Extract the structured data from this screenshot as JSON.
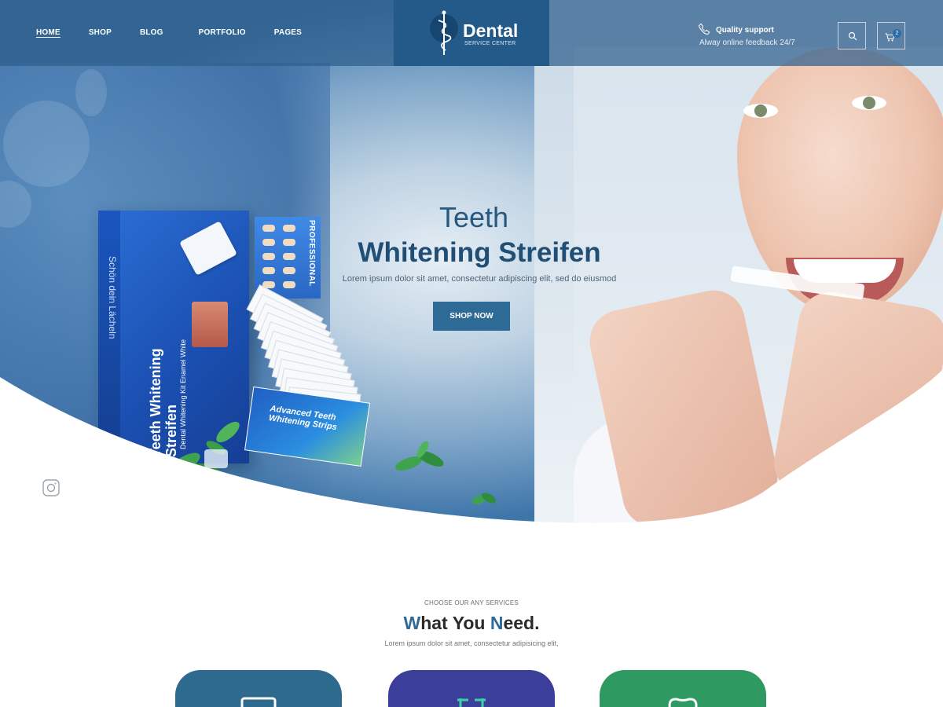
{
  "header": {
    "nav": [
      "HOME",
      "SHOP",
      "BLOG",
      "PORTFOLIO",
      "PAGES"
    ],
    "active_nav": "HOME",
    "logo": {
      "title": "Dental",
      "subtitle": "SERVICE CENTER",
      "icon": "caduceus-icon"
    },
    "support": {
      "title": "Quality support",
      "text": "Alway online feedback 24/7",
      "icon": "phone-icon"
    },
    "search_icon": "search-icon",
    "cart": {
      "icon": "cart-icon",
      "count": "2"
    }
  },
  "hero": {
    "title_line1": "Teeth",
    "title_line2": "Whitening Streifen",
    "subtitle": "Lorem ipsum dolor sit amet, consectetur adipiscing elit, sed do eiusmod",
    "cta": "SHOP NOW",
    "product": {
      "side_text": "Schön dein Lächeln",
      "name": "Teeth Whitening Streifen",
      "name_small": "Dental Whitening Kit Enamel White",
      "card_label": "PROFESSIONAL",
      "pouch_text": "Advanced Teeth Whitening Strips"
    },
    "social_icon": "instagram-icon"
  },
  "services": {
    "kicker": "CHOOSE OUR ANY SERVICES",
    "title_parts": [
      {
        "text": "W",
        "accent": true
      },
      {
        "text": "hat You ",
        "accent": false
      },
      {
        "text": "N",
        "accent": true
      },
      {
        "text": "eed.",
        "accent": false
      }
    ],
    "subtitle": "Lorem ipsum dolor sit amet, consectetur adipisicing elit,",
    "cards": [
      {
        "color": "#2e6a8e",
        "icon": "monitor-icon"
      },
      {
        "color": "#3b3f9a",
        "icon": "tooth-chart-icon"
      },
      {
        "color": "#2e9a62",
        "icon": "tooth-icon"
      }
    ]
  },
  "colors": {
    "primary": "#2e6a96",
    "header_overlay": "#2e5e8c",
    "logo_box": "#235a89",
    "title_text": "#214e74"
  }
}
